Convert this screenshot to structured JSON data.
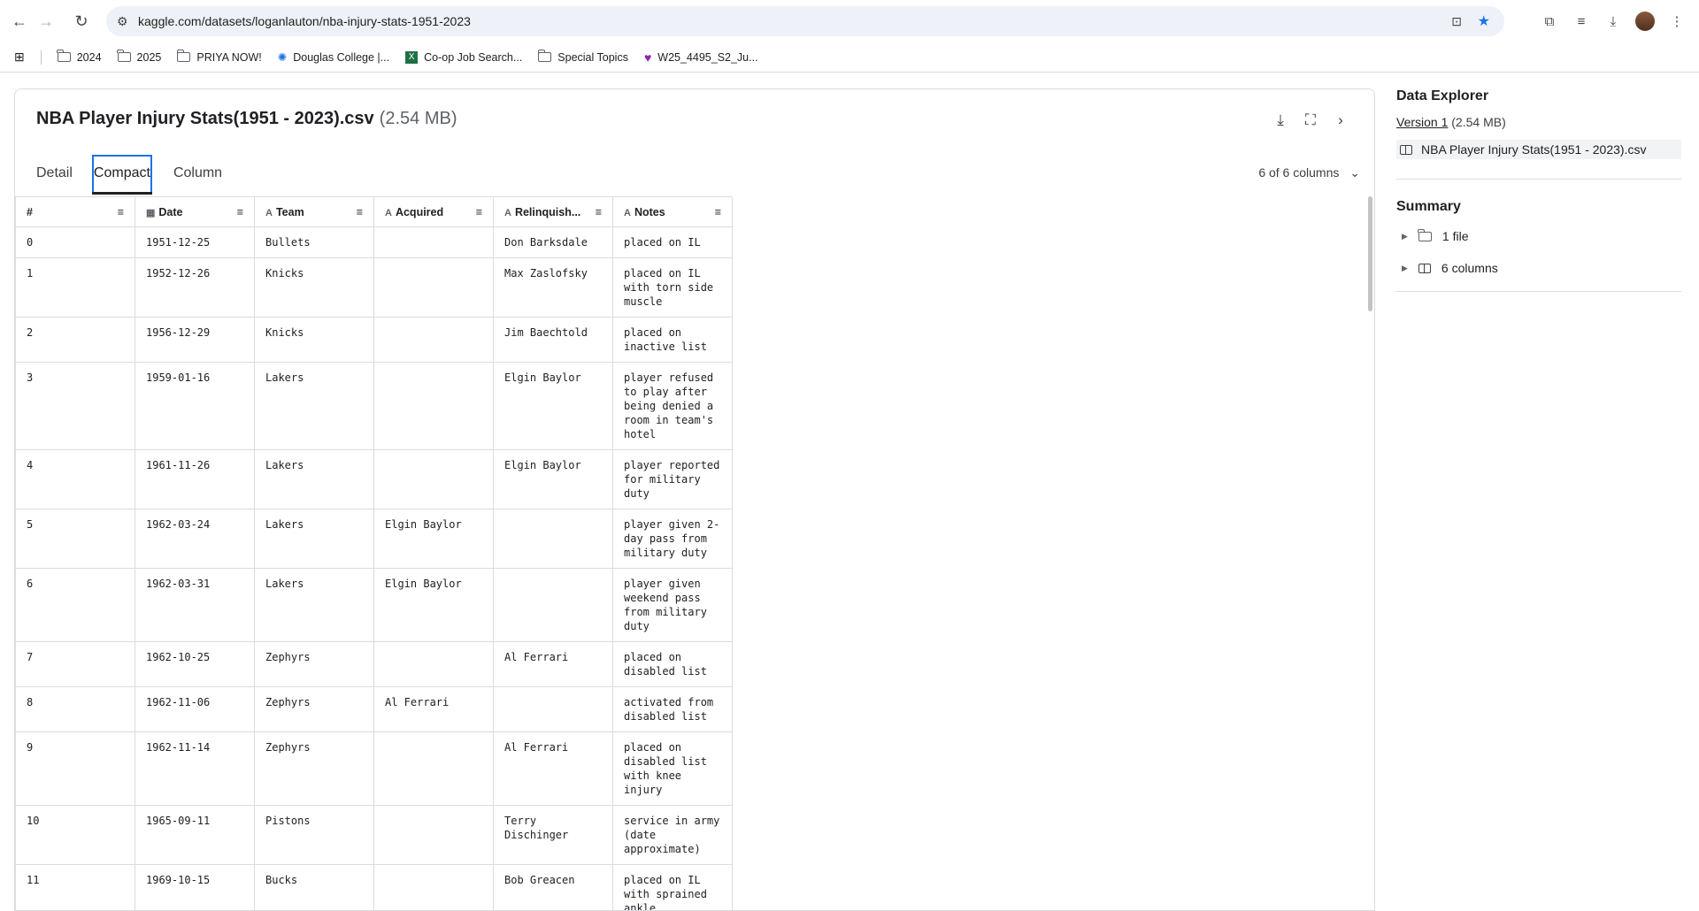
{
  "browser": {
    "url": "kaggle.com/datasets/loganlauton/nba-injury-stats-1951-2023",
    "bookmarks": [
      "2024",
      "2025",
      "PRIYA NOW!",
      "Douglas College |...",
      "Co-op Job Search...",
      "Special Topics",
      "W25_4495_S2_Ju..."
    ]
  },
  "file": {
    "name": "NBA Player Injury Stats(1951 - 2023).csv",
    "size": "(2.54 MB)"
  },
  "tabs": [
    "Detail",
    "Compact",
    "Column"
  ],
  "active_tab": "Compact",
  "column_count": "6 of 6 columns",
  "table": {
    "headers": [
      "#",
      "Date",
      "Team",
      "Acquired",
      "Relinquish...",
      "Notes"
    ],
    "rows": [
      [
        "0",
        "1951-12-25",
        "Bullets",
        "",
        "Don Barksdale",
        "placed on IL"
      ],
      [
        "1",
        "1952-12-26",
        "Knicks",
        "",
        "Max Zaslofsky",
        "placed on IL with torn side muscle"
      ],
      [
        "2",
        "1956-12-29",
        "Knicks",
        "",
        "Jim Baechtold",
        "placed on inactive list"
      ],
      [
        "3",
        "1959-01-16",
        "Lakers",
        "",
        "Elgin Baylor",
        "player refused to play after being denied a room in team's hotel"
      ],
      [
        "4",
        "1961-11-26",
        "Lakers",
        "",
        "Elgin Baylor",
        "player reported for military duty"
      ],
      [
        "5",
        "1962-03-24",
        "Lakers",
        "Elgin Baylor",
        "",
        "player given 2-day pass from military duty"
      ],
      [
        "6",
        "1962-03-31",
        "Lakers",
        "Elgin Baylor",
        "",
        "player given weekend pass from military duty"
      ],
      [
        "7",
        "1962-10-25",
        "Zephyrs",
        "",
        "Al Ferrari",
        "placed on disabled list"
      ],
      [
        "8",
        "1962-11-06",
        "Zephyrs",
        "Al Ferrari",
        "",
        "activated from disabled list"
      ],
      [
        "9",
        "1962-11-14",
        "Zephyrs",
        "",
        "Al Ferrari",
        "placed on disabled list with knee injury"
      ],
      [
        "10",
        "1965-09-11",
        "Pistons",
        "",
        "Terry Dischinger",
        "service in army (date approximate)"
      ],
      [
        "11",
        "1969-10-15",
        "Bucks",
        "",
        "Bob Greacen",
        "placed on IL with sprained ankle"
      ]
    ]
  },
  "sidebar": {
    "title": "Data Explorer",
    "version_link": "Version 1",
    "version_size": "(2.54 MB)",
    "file_name": "NBA Player Injury Stats(1951 - 2023).csv",
    "summary_title": "Summary",
    "summary_items": [
      "1 file",
      "6 columns"
    ]
  }
}
